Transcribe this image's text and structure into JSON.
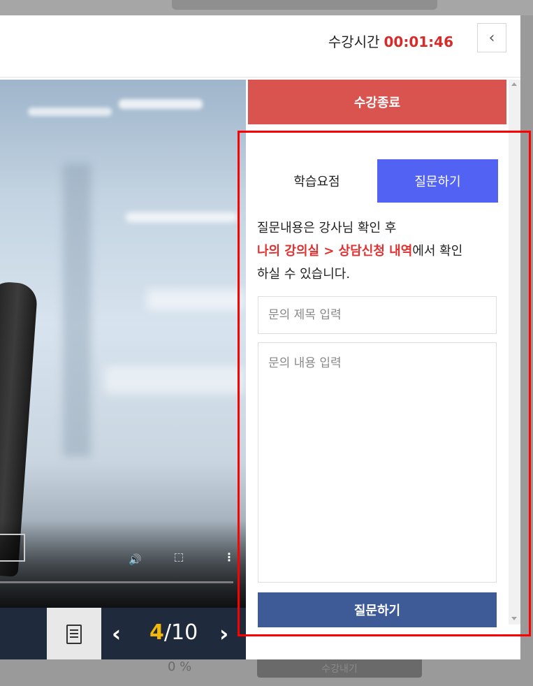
{
  "header": {
    "timer_label": "수강시간",
    "timer_value": "00:01:46",
    "collapse_icon": "chevron-left-icon"
  },
  "panel": {
    "end_button": "수강종료",
    "tabs": [
      {
        "label": "학습요점",
        "active": false
      },
      {
        "label": "질문하기",
        "active": true
      }
    ],
    "info": {
      "line1": "질문내용은 강사님 확인 후",
      "highlight": "나의 강의실 > 상담신청 내역",
      "line2_rest": "에서 확인",
      "line3": "하실 수 있습니다."
    },
    "title_placeholder": "문의 제목 입력",
    "content_placeholder": "문의 내용 입력",
    "submit_label": "질문하기"
  },
  "player": {
    "current_page": "4",
    "total_pages": "/10",
    "icons": [
      "note-icon",
      "volume-icon",
      "fullscreen-icon",
      "more-icon",
      "chevron-left-icon",
      "chevron-right-icon"
    ]
  },
  "background": {
    "percent_text": "0 %",
    "button_text": "수강내기"
  },
  "colors": {
    "timer": "#d52b2b",
    "end_button": "#d9534f",
    "active_tab": "#5262f2",
    "submit": "#3e5a97",
    "highlight_text": "#e1302f",
    "page_current": "#f3b60b"
  }
}
